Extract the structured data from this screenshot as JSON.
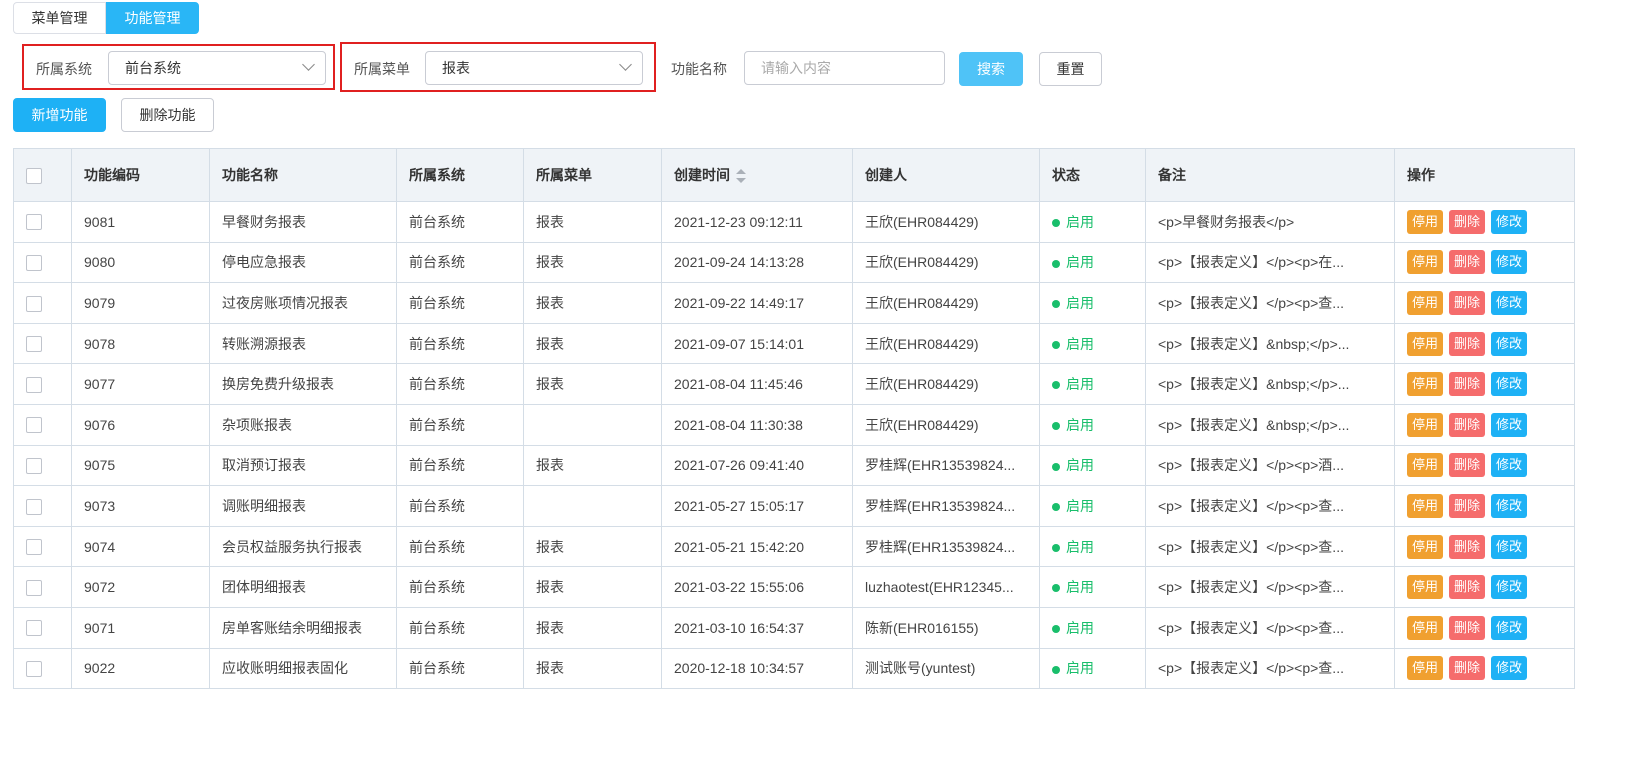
{
  "tabs": [
    {
      "label": "菜单管理"
    },
    {
      "label": "功能管理"
    }
  ],
  "filters": {
    "system_label": "所属系统",
    "system_value": "前台系统",
    "menu_label": "所属菜单",
    "menu_value": "报表",
    "name_label": "功能名称",
    "name_placeholder": "请输入内容",
    "search_label": "搜索",
    "reset_label": "重置"
  },
  "actions": {
    "add_label": "新增功能",
    "delete_label": "删除功能"
  },
  "table": {
    "headers": {
      "code": "功能编码",
      "name": "功能名称",
      "system": "所属系统",
      "menu": "所属菜单",
      "created": "创建时间",
      "creator": "创建人",
      "status": "状态",
      "remark": "备注",
      "ops": "操作"
    },
    "op_labels": {
      "stop": "停用",
      "delete": "删除",
      "edit": "修改"
    },
    "rows": [
      {
        "code": "9081",
        "name": "早餐财务报表",
        "system": "前台系统",
        "menu": "报表",
        "created": "2021-12-23 09:12:11",
        "creator": "王欣(EHR084429)",
        "status": "启用",
        "remark": "<p>早餐财务报表</p>"
      },
      {
        "code": "9080",
        "name": "停电应急报表",
        "system": "前台系统",
        "menu": "报表",
        "created": "2021-09-24 14:13:28",
        "creator": "王欣(EHR084429)",
        "status": "启用",
        "remark": "<p>【报表定义】</p><p>在..."
      },
      {
        "code": "9079",
        "name": "过夜房账项情况报表",
        "system": "前台系统",
        "menu": "报表",
        "created": "2021-09-22 14:49:17",
        "creator": "王欣(EHR084429)",
        "status": "启用",
        "remark": "<p>【报表定义】</p><p>查..."
      },
      {
        "code": "9078",
        "name": "转账溯源报表",
        "system": "前台系统",
        "menu": "报表",
        "created": "2021-09-07 15:14:01",
        "creator": "王欣(EHR084429)",
        "status": "启用",
        "remark": "<p>【报表定义】&nbsp;</p>..."
      },
      {
        "code": "9077",
        "name": "换房免费升级报表",
        "system": "前台系统",
        "menu": "报表",
        "created": "2021-08-04 11:45:46",
        "creator": "王欣(EHR084429)",
        "status": "启用",
        "remark": "<p>【报表定义】&nbsp;</p>..."
      },
      {
        "code": "9076",
        "name": "杂项账报表",
        "system": "前台系统",
        "menu": "",
        "created": "2021-08-04 11:30:38",
        "creator": "王欣(EHR084429)",
        "status": "启用",
        "remark": "<p>【报表定义】&nbsp;</p>..."
      },
      {
        "code": "9075",
        "name": "取消预订报表",
        "system": "前台系统",
        "menu": "报表",
        "created": "2021-07-26 09:41:40",
        "creator": "罗桂辉(EHR13539824...",
        "status": "启用",
        "remark": "<p>【报表定义】</p><p>酒..."
      },
      {
        "code": "9073",
        "name": "调账明细报表",
        "system": "前台系统",
        "menu": "",
        "created": "2021-05-27 15:05:17",
        "creator": "罗桂辉(EHR13539824...",
        "status": "启用",
        "remark": "<p>【报表定义】</p><p>查..."
      },
      {
        "code": "9074",
        "name": "会员权益服务执行报表",
        "system": "前台系统",
        "menu": "报表",
        "created": "2021-05-21 15:42:20",
        "creator": "罗桂辉(EHR13539824...",
        "status": "启用",
        "remark": "<p>【报表定义】</p><p>查..."
      },
      {
        "code": "9072",
        "name": "团体明细报表",
        "system": "前台系统",
        "menu": "报表",
        "created": "2021-03-22 15:55:06",
        "creator": "luzhaotest(EHR12345...",
        "status": "启用",
        "remark": "<p>【报表定义】</p><p>查..."
      },
      {
        "code": "9071",
        "name": "房单客账结余明细报表",
        "system": "前台系统",
        "menu": "报表",
        "created": "2021-03-10 16:54:37",
        "creator": "陈新(EHR016155)",
        "status": "启用",
        "remark": "<p>【报表定义】</p><p>查..."
      },
      {
        "code": "9022",
        "name": "应收账明细报表固化",
        "system": "前台系统",
        "menu": "报表",
        "created": "2020-12-18 10:34:57",
        "creator": "测试账号(yuntest)",
        "status": "启用",
        "remark": "<p>【报表定义】</p><p>查..."
      }
    ]
  },
  "colors": {
    "primary": "#29b6f6",
    "status_ok": "#19be6b",
    "stop": "#f0a030",
    "delete": "#f56c6c",
    "highlight_border": "#e02020"
  }
}
